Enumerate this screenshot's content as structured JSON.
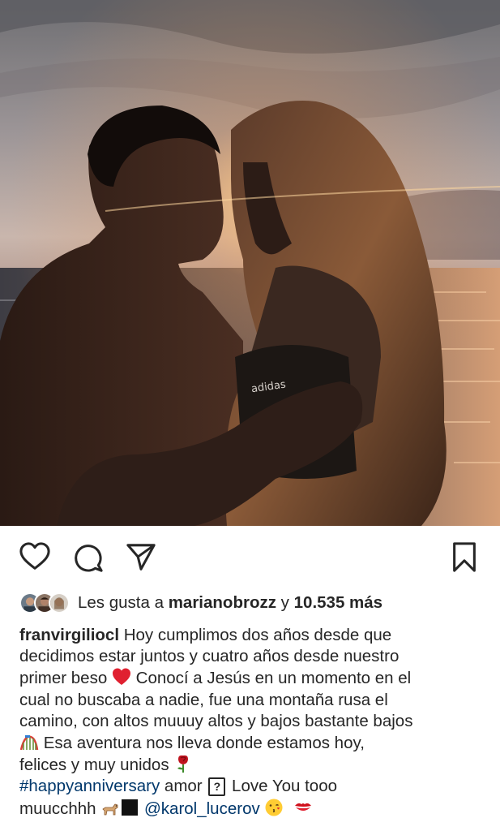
{
  "post": {
    "photo_alt": "couple-kissing-at-sunset-photo",
    "photo_brand_text": "adidas"
  },
  "actions": {
    "like_icon": "heart-icon",
    "comment_icon": "comment-icon",
    "share_icon": "paper-plane-icon",
    "save_icon": "bookmark-icon"
  },
  "likes": {
    "prefix": "Les gusta a ",
    "user": "marianobrozz",
    "middle": " y ",
    "count": "10.535 más"
  },
  "caption": {
    "username": "franvirgiliocl",
    "l1": " Hoy cumplimos dos años desde que",
    "l2": "decidimos estar juntos y cuatro años desde nuestro",
    "l3a": "primer beso ",
    "l3b": " Conocí a Jesús en un momento en el",
    "l4": "cual no buscaba a nadie, fue una montaña rusa el",
    "l5": "camino, con altos muuuy altos y bajos bastante bajos",
    "l6": " Esa aventura nos lleva donde estamos hoy,",
    "l7": "felices y muy unidos ",
    "hashtag": "#happyanniversary",
    "l8a": " amor ",
    "l8q": "?",
    "l8b": " Love You tooo",
    "l9a": "muucchhh ",
    "mention": "@karol_lucerov",
    "emojis": [
      "red-heart-icon",
      "roller-coaster-icon",
      "rose-icon",
      "dog-icon",
      "black-square-icon",
      "kissing-face-icon",
      "kiss-mark-icon"
    ]
  },
  "colors": {
    "link": "#00376b",
    "text": "#262626",
    "heart": "#e02030"
  }
}
